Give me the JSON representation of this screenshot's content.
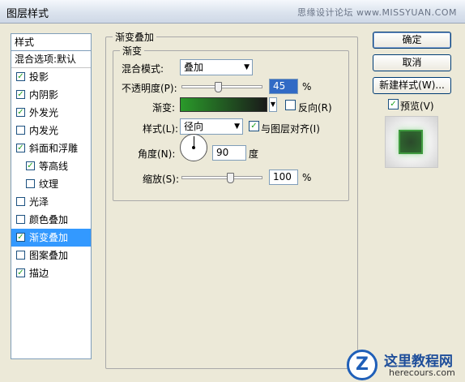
{
  "window": {
    "title": "图层样式",
    "watermark": "思缘设计论坛 www.MISSYUAN.COM"
  },
  "styles": {
    "header": "样式",
    "blend_options": "混合选项:默认",
    "items": [
      {
        "label": "投影",
        "checked": true,
        "sub": false,
        "selected": false
      },
      {
        "label": "内阴影",
        "checked": true,
        "sub": false,
        "selected": false
      },
      {
        "label": "外发光",
        "checked": true,
        "sub": false,
        "selected": false
      },
      {
        "label": "内发光",
        "checked": false,
        "sub": false,
        "selected": false
      },
      {
        "label": "斜面和浮雕",
        "checked": true,
        "sub": false,
        "selected": false
      },
      {
        "label": "等高线",
        "checked": true,
        "sub": true,
        "selected": false
      },
      {
        "label": "纹理",
        "checked": false,
        "sub": true,
        "selected": false
      },
      {
        "label": "光泽",
        "checked": false,
        "sub": false,
        "selected": false
      },
      {
        "label": "颜色叠加",
        "checked": false,
        "sub": false,
        "selected": false
      },
      {
        "label": "渐变叠加",
        "checked": true,
        "sub": false,
        "selected": true
      },
      {
        "label": "图案叠加",
        "checked": false,
        "sub": false,
        "selected": false
      },
      {
        "label": "描边",
        "checked": true,
        "sub": false,
        "selected": false
      }
    ]
  },
  "gradient_overlay": {
    "group_title": "渐变叠加",
    "sub_group_title": "渐变",
    "blend_mode_label": "混合模式:",
    "blend_mode_value": "叠加",
    "opacity_label": "不透明度(P):",
    "opacity_value": "45",
    "opacity_unit": "%",
    "opacity_level": 0.45,
    "gradient_label": "渐变:",
    "gradient_colors": [
      "#2a9a2a",
      "#1a1a1a"
    ],
    "reverse_label": "反向(R)",
    "reverse_checked": false,
    "style_label": "样式(L):",
    "style_value": "径向",
    "align_label": "与图层对齐(I)",
    "align_checked": true,
    "angle_label": "角度(N):",
    "angle_value": "90",
    "angle_unit": "度",
    "scale_label": "缩放(S):",
    "scale_value": "100",
    "scale_unit": "%",
    "scale_level": 0.6
  },
  "buttons": {
    "ok": "确定",
    "cancel": "取消",
    "new_style": "新建样式(W)...",
    "preview_label": "预览(V)",
    "preview_checked": true
  },
  "logo": {
    "mark": "Z",
    "main": "这里教程网",
    "sub": "herecours.com"
  },
  "colors": {
    "selected_bg": "#3399ff",
    "check_green": "#21a121",
    "preview_green": "#2f6b2f"
  }
}
